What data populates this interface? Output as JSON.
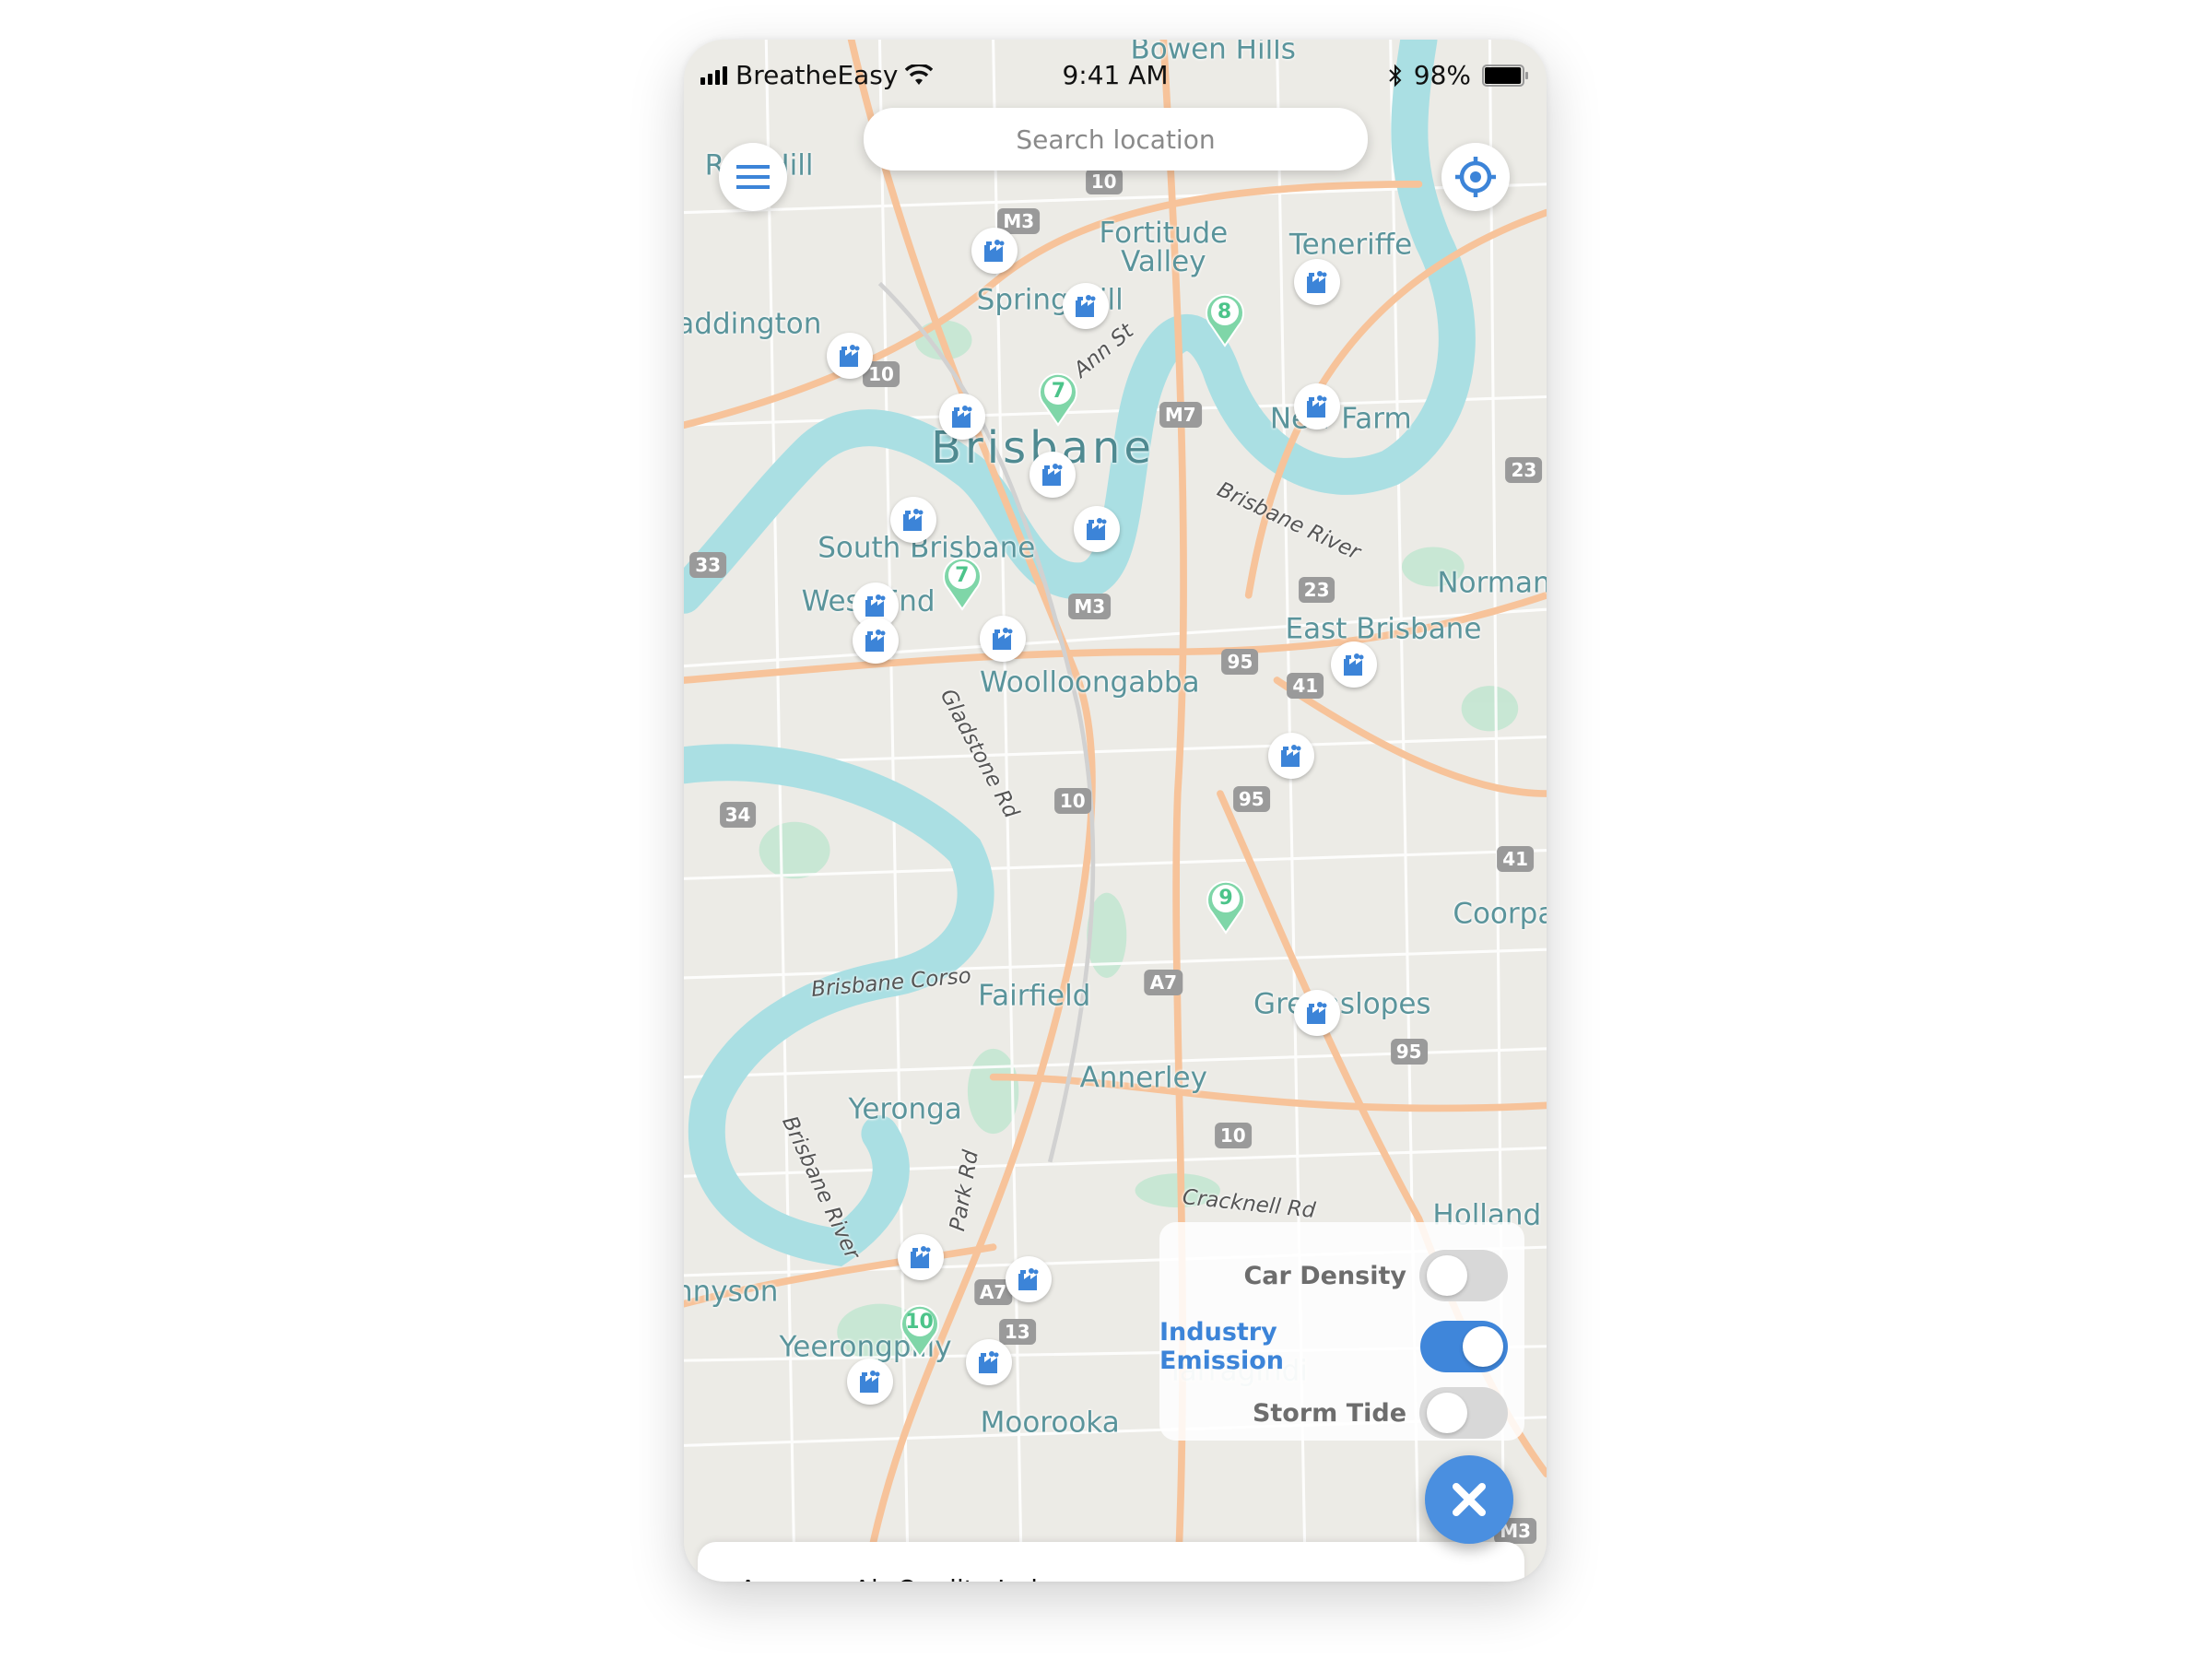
{
  "status_bar": {
    "carrier": "BreatheEasy",
    "time": "9:41 AM",
    "battery": "98%",
    "battery_level": 0.98
  },
  "search": {
    "placeholder": "Search location"
  },
  "icons": {
    "menu": "hamburger-menu-icon",
    "locate": "crosshair-locate-icon",
    "close": "close-x-icon",
    "factory": "factory-icon",
    "pin": "aqi-pin-icon"
  },
  "map": {
    "labels": [
      "Bowen Hills",
      "Red Hill",
      "Fortitude\nValley",
      "Teneriffe",
      "Spring Hill",
      "addington",
      "New Farm",
      "Brisbane",
      "South Brisbane",
      "West End",
      "Woolloongabba",
      "East Brisbane",
      "Norman",
      "Coorpa",
      "Fairfield",
      "Greenslopes",
      "Annerley",
      "Yeronga",
      "Yeerongpilly",
      "Moorooka",
      "nnyson",
      "Holland",
      "Tarragindi"
    ],
    "road_labels": [
      "Ann St",
      "Brisbane River",
      "Gladstone Rd",
      "Brisbane Corso",
      "Park Rd",
      "Cracknell Rd",
      "Brisbane River"
    ],
    "shields": [
      "M3",
      "M3",
      "M7",
      "A7",
      "A7",
      "10",
      "10",
      "10",
      "10",
      "23",
      "23",
      "95",
      "95",
      "95",
      "41",
      "41",
      "33",
      "34",
      "13",
      "M3"
    ],
    "aqi_pins": [
      "8",
      "7",
      "7",
      "9",
      "10"
    ]
  },
  "layers": {
    "items": [
      {
        "label": "Car Density",
        "enabled": false
      },
      {
        "label": "Industry Emission",
        "enabled": true
      },
      {
        "label": "Storm Tide",
        "enabled": false
      }
    ]
  },
  "bottom_sheet": {
    "title": "Average Air Quality Index:"
  },
  "colors": {
    "accent": "#4a8fe0",
    "aqi_good": "#4cc48a",
    "water": "#aadfe3",
    "road": "#f7c39a"
  }
}
